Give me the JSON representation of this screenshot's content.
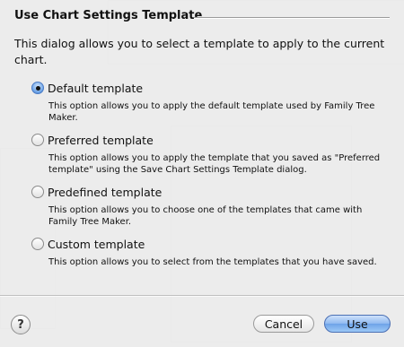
{
  "dialog": {
    "title": "Use Chart Settings Template",
    "intro": "This dialog allows you to select a template to apply to the current chart.",
    "options": [
      {
        "label": "Default template",
        "description": "This option allows you to apply the default template used by Family Tree Maker.",
        "selected": true
      },
      {
        "label": "Preferred template",
        "description": "This option allows you to apply the template that you saved as \"Preferred template\" using the Save Chart Settings Template dialog.",
        "selected": false
      },
      {
        "label": "Predefined template",
        "description": "This option allows you to choose one of the templates that came with Family Tree Maker.",
        "selected": false
      },
      {
        "label": "Custom template",
        "description": "This option allows you to select from the templates that you have saved.",
        "selected": false
      }
    ]
  },
  "footer": {
    "help_label": "?",
    "cancel_label": "Cancel",
    "use_label": "Use"
  },
  "colors": {
    "sheet_background": "#ececec",
    "default_button": "#8fb9f0",
    "radio_selected": "#7fb0ec"
  }
}
